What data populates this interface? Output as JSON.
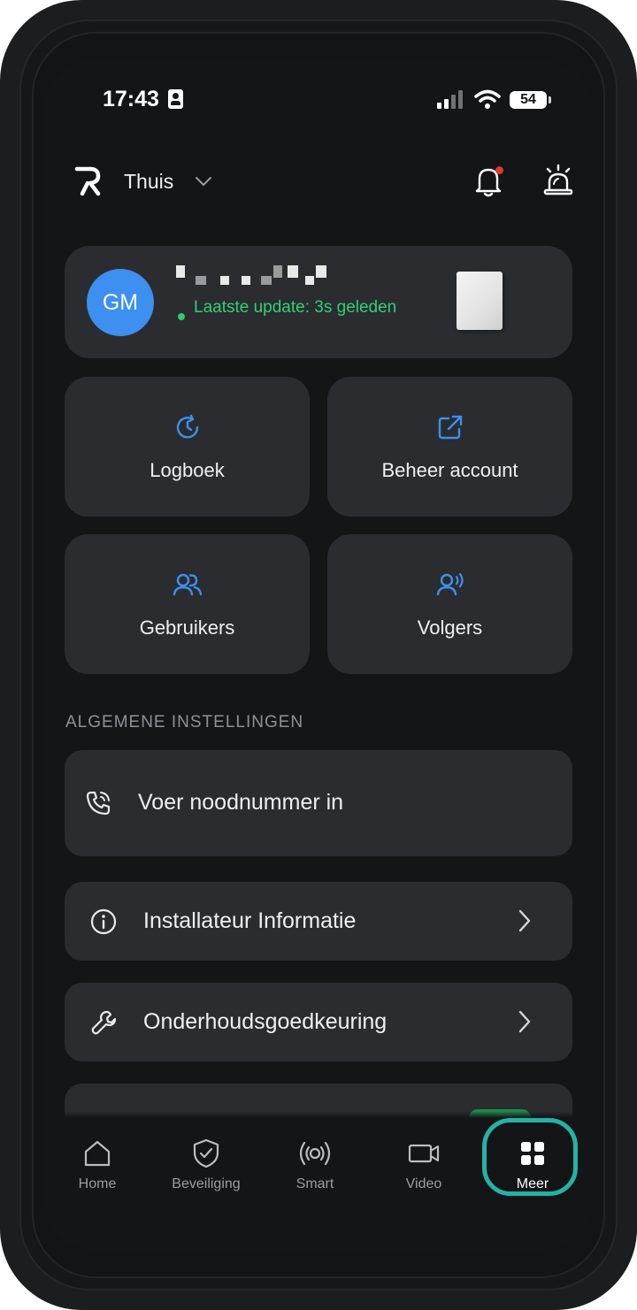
{
  "status_bar": {
    "time": "17:43",
    "battery": "54"
  },
  "header": {
    "location": "Thuis"
  },
  "account_card": {
    "avatar_initials": "GM",
    "update_status": "Laatste update: 3s geleden"
  },
  "tiles": [
    {
      "label": "Logboek",
      "icon": "history-icon"
    },
    {
      "label": "Beheer account",
      "icon": "external-link-icon"
    },
    {
      "label": "Gebruikers",
      "icon": "users-icon"
    },
    {
      "label": "Volgers",
      "icon": "followers-icon"
    }
  ],
  "general_settings": {
    "title": "ALGEMENE INSTELLINGEN",
    "items": [
      {
        "label": "Voer noodnummer in",
        "icon": "phone-call-icon"
      },
      {
        "label": "Installateur Informatie",
        "icon": "info-icon"
      },
      {
        "label": "Onderhoudsgoedkeuring",
        "icon": "wrench-icon"
      }
    ]
  },
  "bottom_nav": {
    "items": [
      {
        "label": "Home",
        "icon": "home-icon"
      },
      {
        "label": "Beveiliging",
        "icon": "shield-check-icon"
      },
      {
        "label": "Smart",
        "icon": "broadcast-icon"
      },
      {
        "label": "Video",
        "icon": "video-camera-icon"
      },
      {
        "label": "Meer",
        "icon": "grid-icon",
        "active": true
      }
    ]
  },
  "colors": {
    "background": "#141517",
    "card": "#2a2c2f",
    "accent_blue": "#3d8ff0",
    "status_green": "#2fd179",
    "highlight_teal": "#25b2a6"
  }
}
